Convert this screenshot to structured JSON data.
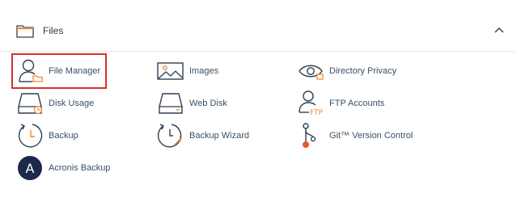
{
  "section": {
    "title": "Files",
    "header_icon": "folder-icon",
    "collapse_icon": "chevron-up-icon"
  },
  "tools": {
    "file_manager": "File Manager",
    "images": "Images",
    "directory_privacy": "Directory Privacy",
    "disk_usage": "Disk Usage",
    "web_disk": "Web Disk",
    "ftp_accounts": "FTP Accounts",
    "backup": "Backup",
    "backup_wizard": "Backup Wizard",
    "git_version_control": "Git™ Version Control",
    "acronis_backup": "Acronis Backup"
  },
  "ftp_icon_text": "FTP",
  "acronis_icon_letter": "A",
  "colors": {
    "icon_stroke": "#2d3e50",
    "accent_orange": "#f08a34",
    "highlight_border": "#d9302b",
    "label_text": "#3b4f62",
    "acronis_bg": "#1b2a4a"
  }
}
